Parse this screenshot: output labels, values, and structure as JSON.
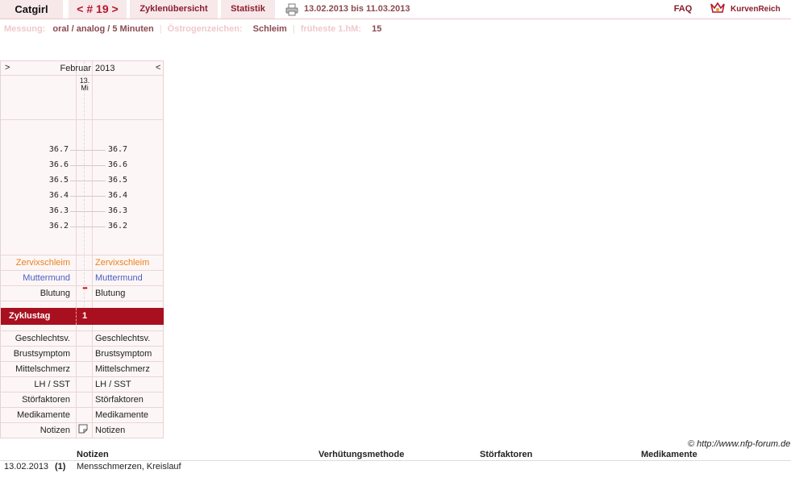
{
  "header": {
    "user": "Catgirl",
    "cycle_nav": "< # 19 >",
    "tab_overview": "Zyklenübersicht",
    "tab_stats": "Statistik",
    "date_range": "13.02.2013 bis 11.03.2013",
    "faq": "FAQ",
    "logo_text": "KurvenReich"
  },
  "info": {
    "measure_label": "Messung:",
    "measure_value": "oral / analog / 5 Minuten",
    "estrogen_label": "Östrogenzeichen:",
    "estrogen_value": "Schleim",
    "earliest_label": "früheste 1.hM:",
    "earliest_value": "15"
  },
  "chart": {
    "prev_arrow": ">",
    "next_arrow": "<",
    "month": "Februar",
    "year": "2013",
    "day_num": "13.",
    "day_name": "Mi",
    "temps": [
      "36.7",
      "36.6",
      "36.5",
      "36.4",
      "36.3",
      "36.2"
    ],
    "rows": {
      "zervix": "Zervixschleim",
      "muttermund": "Muttermund",
      "blutung": "Blutung",
      "blutung_mark": "•••",
      "zyklustag": "Zyklustag",
      "zyklustag_value": "1",
      "geschlecht": "Geschlechtsv.",
      "brust": "Brustsymptom",
      "mittel": "Mittelschmerz",
      "lh": "LH / SST",
      "stoer": "Störfaktoren",
      "medi": "Medikamente",
      "notizen": "Notizen"
    },
    "colors": {
      "zervix": "#e8821e",
      "muttermund": "#4a5fc1",
      "zyklustag_bg": "#a8101f"
    }
  },
  "footer": {
    "copyright": "© http://www.nfp-forum.de",
    "columns": [
      "Notizen",
      "Verhütungsmethode",
      "Störfaktoren",
      "Medikamente"
    ],
    "rows": [
      {
        "date": "13.02.2013",
        "num": "(1)",
        "note": "Mensschmerzen, Kreislauf"
      }
    ]
  }
}
